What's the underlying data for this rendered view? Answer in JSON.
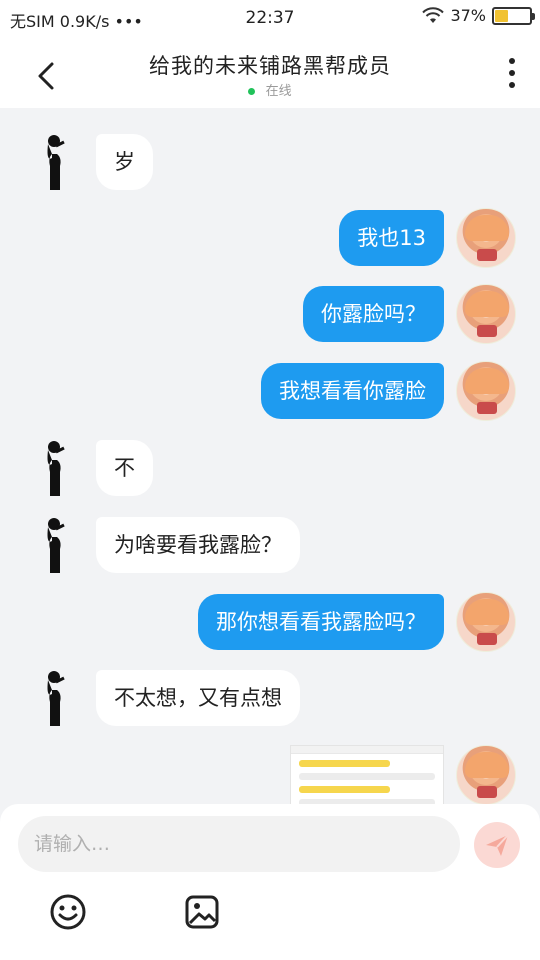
{
  "status_bar": {
    "carrier": "无SIM",
    "speed": "0.9K/s",
    "dots": "•••",
    "time": "22:37",
    "battery_text": "37%",
    "battery_level": 0.37
  },
  "header": {
    "title": "给我的未来铺路黑帮成员",
    "presence": "在线",
    "presence_color": "#21c25a"
  },
  "messages": [
    {
      "side": "in",
      "text": "岁"
    },
    {
      "side": "out",
      "text": "我也13"
    },
    {
      "side": "out",
      "text": "你露脸吗？"
    },
    {
      "side": "out",
      "text": "我想看看你露脸"
    },
    {
      "side": "in",
      "text": "不"
    },
    {
      "side": "in",
      "text": "为啥要看我露脸？"
    },
    {
      "side": "out",
      "text": "那你想看看我露脸吗？"
    },
    {
      "side": "in",
      "text": "不太想，又有点想"
    },
    {
      "side": "out",
      "type": "image",
      "text": ""
    }
  ],
  "input": {
    "placeholder": "请输入…"
  },
  "colors": {
    "outgoing_bubble": "#1e9bf0",
    "incoming_bubble": "#ffffff",
    "background": "#f2f3f5"
  },
  "icons": [
    "back-arrow-icon",
    "more-vertical-icon",
    "wifi-icon",
    "battery-icon",
    "send-icon",
    "emoji-icon",
    "image-icon"
  ]
}
